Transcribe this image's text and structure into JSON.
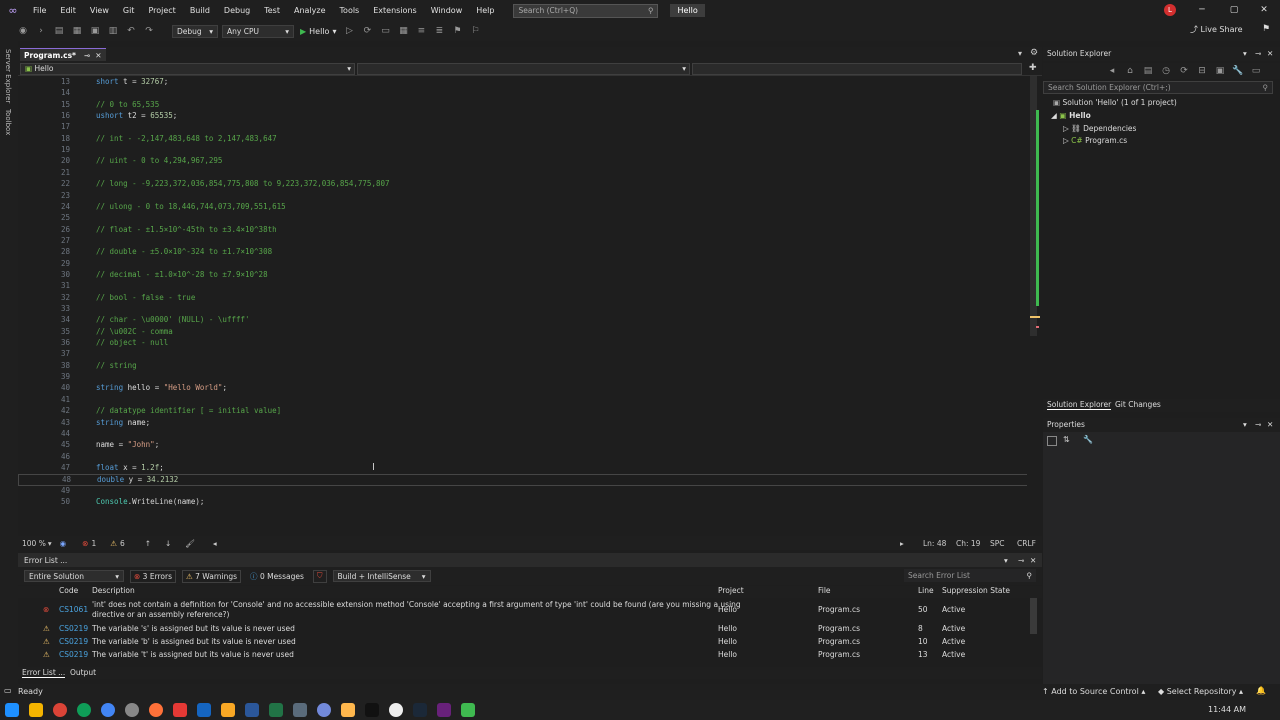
{
  "menubar": {
    "items": [
      "File",
      "Edit",
      "View",
      "Git",
      "Project",
      "Build",
      "Debug",
      "Test",
      "Analyze",
      "Tools",
      "Extensions",
      "Window",
      "Help"
    ],
    "search_placeholder": "Search (Ctrl+Q)",
    "solution_name": "Hello",
    "user_initial": "L"
  },
  "toolbar": {
    "config": "Debug",
    "platform": "Any CPU",
    "run_label": "Hello",
    "live_share": "Live Share"
  },
  "left_rail": {
    "server_explorer": "Server Explorer",
    "toolbox": "Toolbox"
  },
  "editor": {
    "tab_label": "Program.cs*",
    "nav_project": "Hello",
    "lines": [
      {
        "n": "13",
        "html": "<span class=\"kw\">short</span> <span class=\"id\">t</span> = <span class=\"num\">32767</span>;"
      },
      {
        "n": "14",
        "html": ""
      },
      {
        "n": "15",
        "html": "<span class=\"cmt\">// 0 to 65,535</span>"
      },
      {
        "n": "16",
        "html": "<span class=\"kw\">ushort</span> <span class=\"id\">t2</span> = <span class=\"num\">65535</span>;"
      },
      {
        "n": "17",
        "html": ""
      },
      {
        "n": "18",
        "html": "<span class=\"cmt\">// int - -2,147,483,648 to 2,147,483,647</span>"
      },
      {
        "n": "19",
        "html": ""
      },
      {
        "n": "20",
        "html": "<span class=\"cmt\">// uint - 0 to 4,294,967,295</span>"
      },
      {
        "n": "21",
        "html": ""
      },
      {
        "n": "22",
        "html": "<span class=\"cmt\">// long - -9,223,372,036,854,775,808 to 9,223,372,036,854,775,807</span>"
      },
      {
        "n": "23",
        "html": ""
      },
      {
        "n": "24",
        "html": "<span class=\"cmt\">// ulong - 0 to 18,446,744,073,709,551,615</span>"
      },
      {
        "n": "25",
        "html": ""
      },
      {
        "n": "26",
        "html": "<span class=\"cmt\">// float - ±1.5×10^-45th to ±3.4×10^38th</span>"
      },
      {
        "n": "27",
        "html": ""
      },
      {
        "n": "28",
        "html": "<span class=\"cmt\">// double - ±5.0×10^-324 to ±1.7×10^308</span>"
      },
      {
        "n": "29",
        "html": ""
      },
      {
        "n": "30",
        "html": "<span class=\"cmt\">// decimal - ±1.0×10^-28 to ±7.9×10^28</span>"
      },
      {
        "n": "31",
        "html": ""
      },
      {
        "n": "32",
        "html": "<span class=\"cmt\">// bool - false - true</span>"
      },
      {
        "n": "33",
        "html": ""
      },
      {
        "n": "34",
        "html": "<span class=\"cmt\">// char - \\u0000' (NULL) - \\uffff'</span>"
      },
      {
        "n": "35",
        "html": "<span class=\"cmt\">// \\u002C - comma</span>"
      },
      {
        "n": "36",
        "html": "<span class=\"cmt\">// object - null</span>"
      },
      {
        "n": "37",
        "html": ""
      },
      {
        "n": "38",
        "html": "<span class=\"cmt\">// string</span>"
      },
      {
        "n": "39",
        "html": ""
      },
      {
        "n": "40",
        "html": "<span class=\"kw\">string</span> <span class=\"id\">hello</span> = <span class=\"str\">\"Hello World\"</span>;"
      },
      {
        "n": "41",
        "html": ""
      },
      {
        "n": "42",
        "html": "<span class=\"cmt\">// datatype identifier [ = initial value]</span>"
      },
      {
        "n": "43",
        "html": "<span class=\"kw\">string</span> <span class=\"id\">name</span>;"
      },
      {
        "n": "44",
        "html": ""
      },
      {
        "n": "45",
        "html": "<span class=\"id\">name</span> = <span class=\"str\">\"John\"</span>;"
      },
      {
        "n": "46",
        "html": ""
      },
      {
        "n": "47",
        "html": "<span class=\"kw\">float</span> <span class=\"id\">x</span> = <span class=\"num\">1.2f</span>;"
      },
      {
        "n": "48",
        "html": "<span class=\"kw\">double</span> <span class=\"id\">y</span> = <span class=\"num\">34.2132</span>"
      },
      {
        "n": "49",
        "html": ""
      },
      {
        "n": "50",
        "html": "<span class=\"cls\">Console</span>.WriteLine(<span class=\"id\">name</span>);"
      }
    ],
    "current_line_number": "48",
    "zoom": "100 %",
    "error_count": "1",
    "warning_count": "6",
    "ln": "Ln: 48",
    "ch": "Ch: 19",
    "spc": "SPC",
    "crlf": "CRLF"
  },
  "error_list": {
    "title": "Error List ...",
    "scope": "Entire Solution",
    "errors_btn": "3 Errors",
    "warnings_btn": "7 Warnings",
    "messages_btn": "0 Messages",
    "build_filter": "Build + IntelliSense",
    "search_placeholder": "Search Error List",
    "columns": {
      "code": "Code",
      "description": "Description",
      "project": "Project",
      "file": "File",
      "line": "Line",
      "suppression": "Suppression State"
    },
    "rows": [
      {
        "icon": "error",
        "code": "CS1061",
        "desc1": "'int' does not contain a definition for 'Console' and no accessible extension method 'Console' accepting a first argument of type 'int' could be found (are you missing a using",
        "desc2": "directive or an assembly reference?)",
        "project": "Hello",
        "file": "Program.cs",
        "line": "50",
        "state": "Active"
      },
      {
        "icon": "warning",
        "code": "CS0219",
        "desc1": "The variable 's' is assigned but its value is never used",
        "desc2": "",
        "project": "Hello",
        "file": "Program.cs",
        "line": "8",
        "state": "Active"
      },
      {
        "icon": "warning",
        "code": "CS0219",
        "desc1": "The variable 'b' is assigned but its value is never used",
        "desc2": "",
        "project": "Hello",
        "file": "Program.cs",
        "line": "10",
        "state": "Active"
      },
      {
        "icon": "warning",
        "code": "CS0219",
        "desc1": "The variable 't' is assigned but its value is never used",
        "desc2": "",
        "project": "Hello",
        "file": "Program.cs",
        "line": "13",
        "state": "Active"
      }
    ],
    "tab_error_list": "Error List ...",
    "tab_output": "Output"
  },
  "solution_explorer": {
    "title": "Solution Explorer",
    "search_placeholder": "Search Solution Explorer (Ctrl+;)",
    "solution_label": "Solution 'Hello' (1 of 1 project)",
    "project_label": "Hello",
    "dependencies_label": "Dependencies",
    "program_label": "Program.cs",
    "tab_se": "Solution Explorer",
    "tab_git": "Git Changes"
  },
  "properties": {
    "title": "Properties"
  },
  "statusbar": {
    "ready": "Ready",
    "add_source": "Add to Source Control",
    "select_repo": "Select Repository"
  },
  "taskbar": {
    "time": "11:44 AM"
  }
}
